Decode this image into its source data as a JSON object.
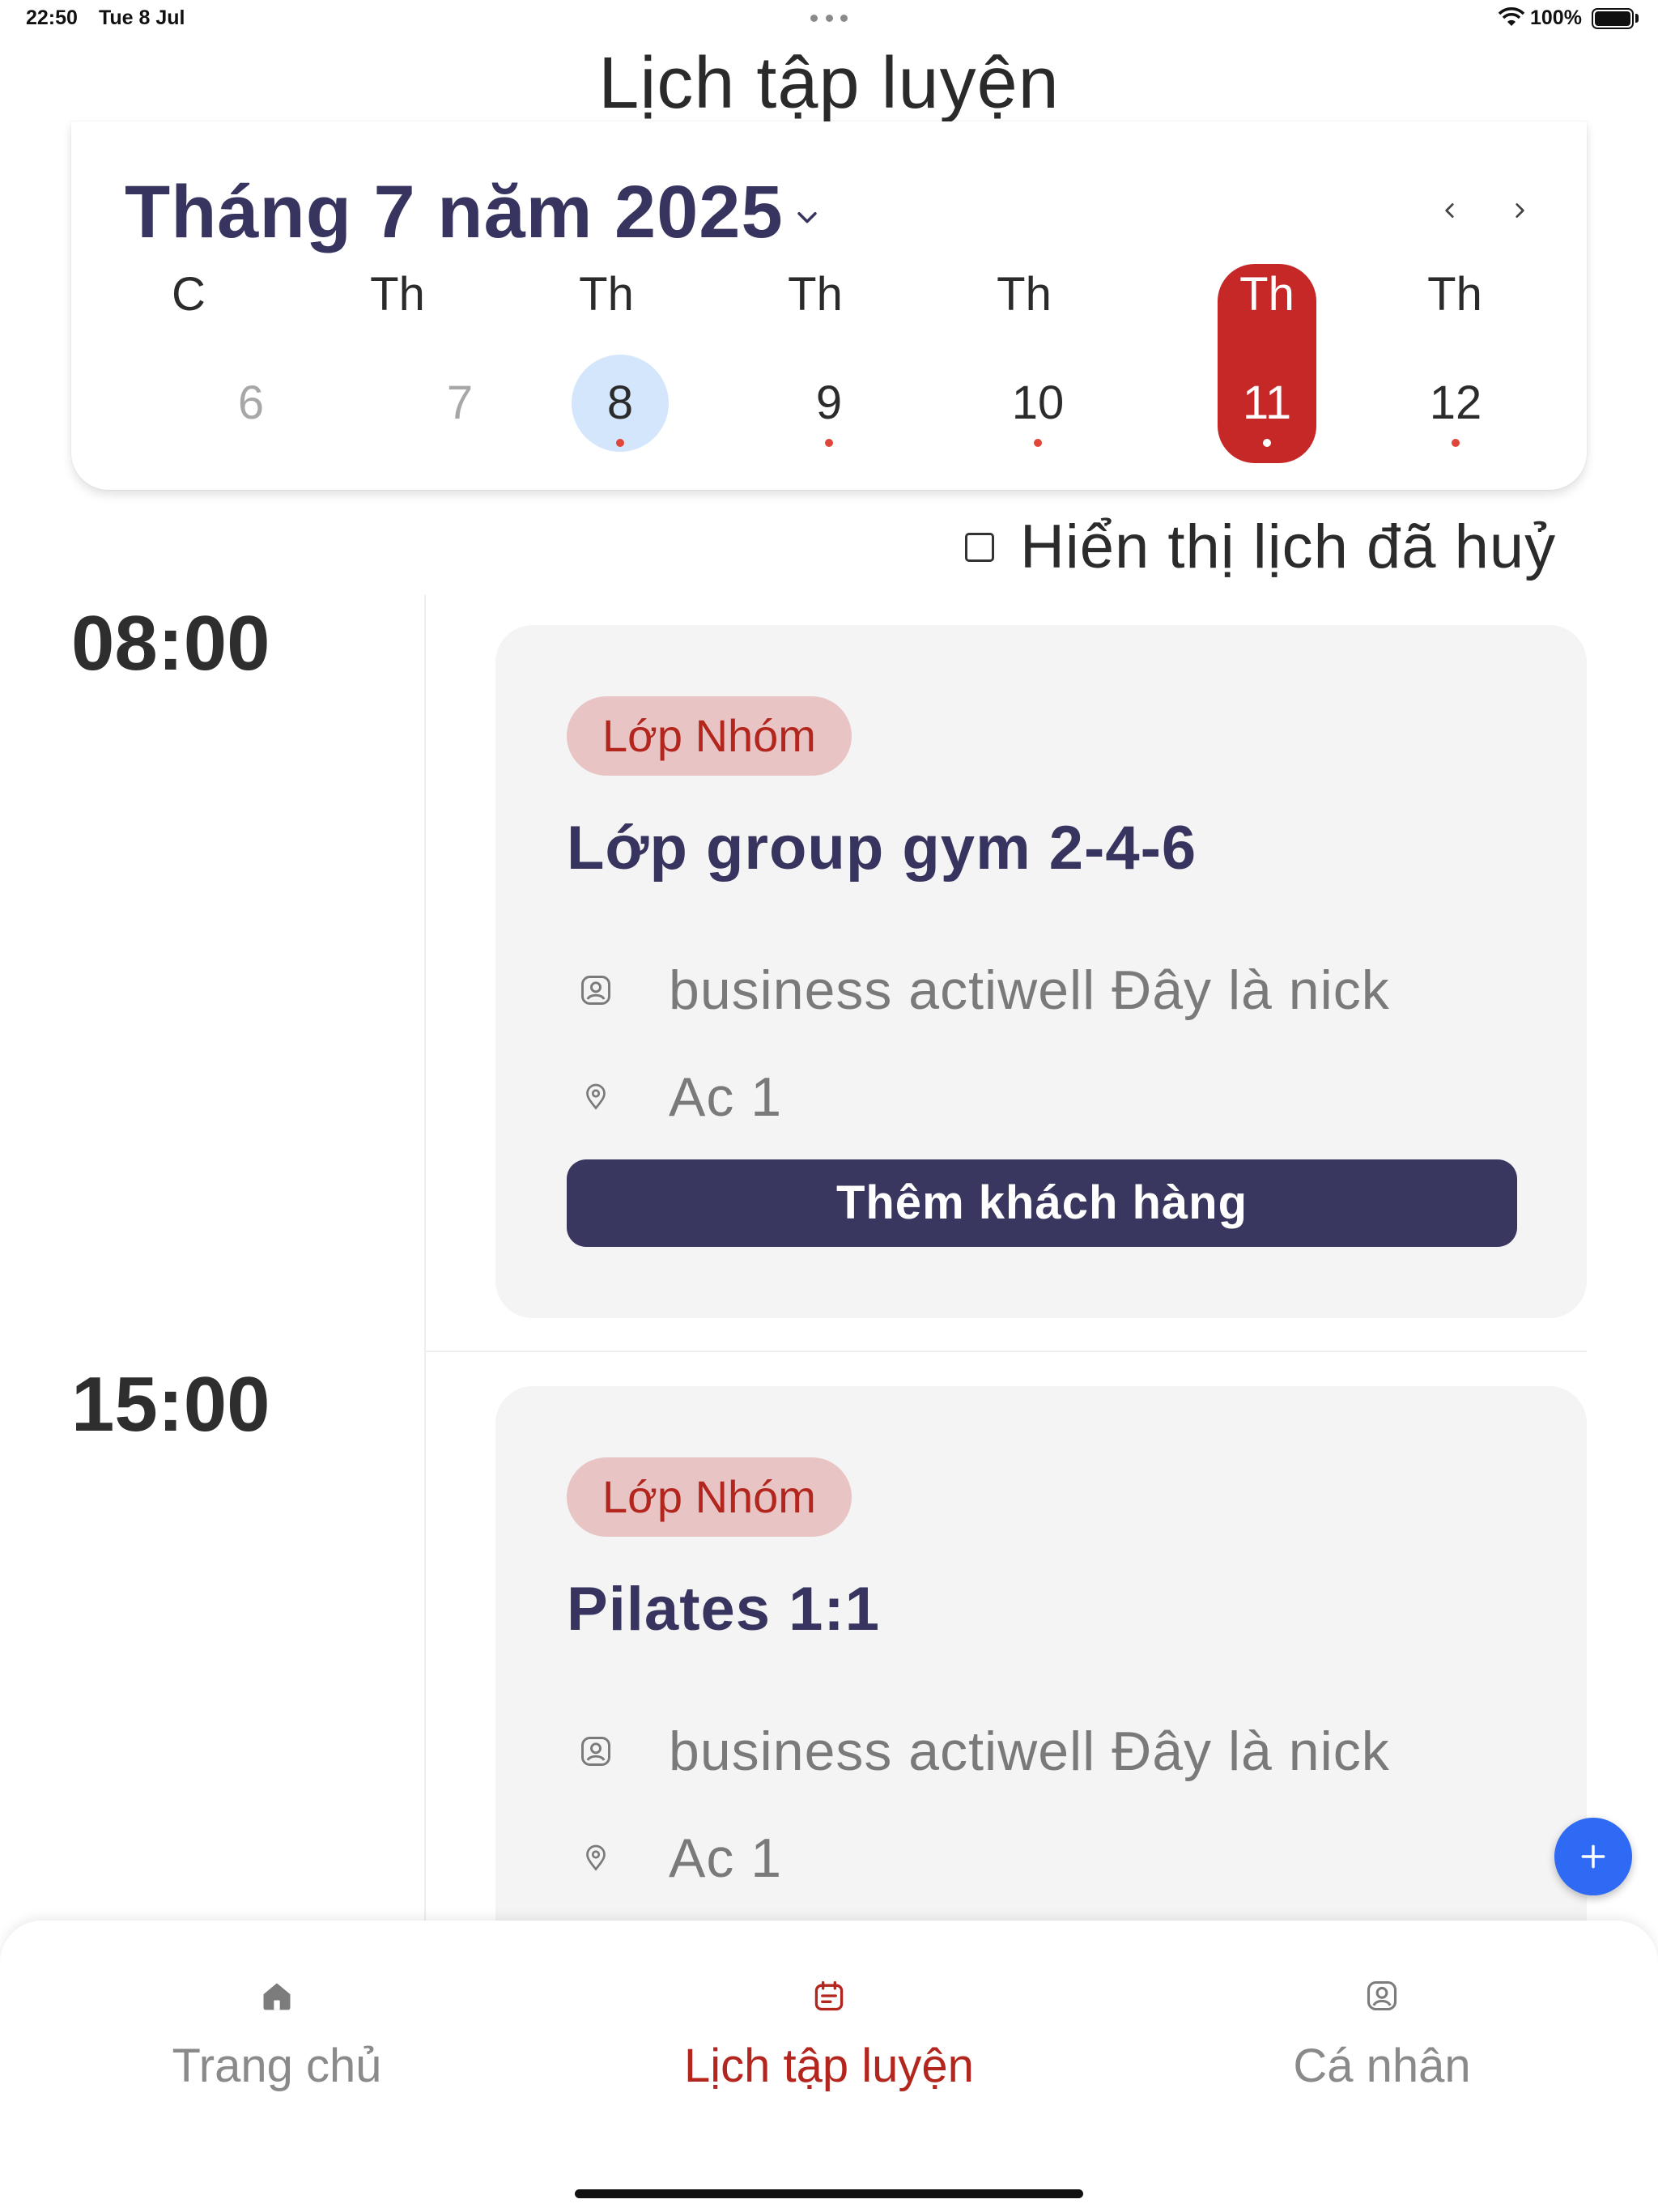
{
  "status_bar": {
    "time": "22:50",
    "date": "Tue 8 Jul",
    "battery": "100%"
  },
  "page": {
    "title": "Lịch tập luyện"
  },
  "calendar": {
    "month_title": "Tháng 7 năm 2025",
    "weekdays": [
      "C",
      "Th",
      "Th",
      "Th",
      "Th",
      "Th",
      "Th"
    ],
    "days": [
      {
        "label": "6",
        "muted": true,
        "has_event": false
      },
      {
        "label": "7",
        "muted": true,
        "has_event": false
      },
      {
        "label": "8",
        "today": true,
        "has_event": true
      },
      {
        "label": "9",
        "has_event": true
      },
      {
        "label": "10",
        "has_event": true
      },
      {
        "label": "11",
        "selected": true,
        "has_event": true
      },
      {
        "label": "12",
        "has_event": true
      }
    ],
    "selected_color": "#c62828",
    "today_color": "#d4e6fb",
    "event_dot_color": "#e0473a"
  },
  "filter": {
    "show_cancelled_label": "Hiển thị lịch đã huỷ",
    "checked": false
  },
  "sessions": [
    {
      "time": "08:00",
      "tag": "Lớp Nhóm",
      "title": "Lớp group gym 2-4-6",
      "trainer": "business actiwell Đây là nick",
      "location": "Ac 1",
      "action_label": "Thêm khách hàng"
    },
    {
      "time": "15:00",
      "tag": "Lớp Nhóm",
      "title": "Pilates 1:1",
      "trainer": "business actiwell Đây là nick",
      "location": "Ac 1"
    }
  ],
  "bottom_nav": {
    "items": [
      {
        "label": "Trang chủ",
        "icon": "home-icon"
      },
      {
        "label": "Lịch tập luyện",
        "icon": "calendar-icon",
        "active": true
      },
      {
        "label": "Cá nhân",
        "icon": "profile-icon"
      }
    ]
  },
  "colors": {
    "brand": "#37355f",
    "accent": "#b3261e",
    "fab": "#2f6af5"
  }
}
